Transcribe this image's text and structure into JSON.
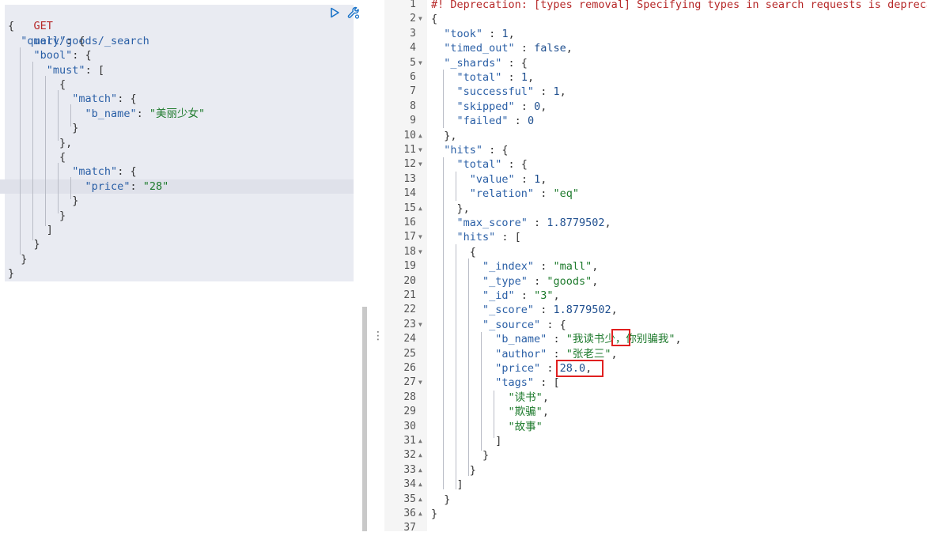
{
  "request": {
    "method": "GET",
    "path": "mall/goods/_search",
    "lines": [
      [
        [
          "p",
          "{"
        ]
      ],
      [
        [
          "p",
          "  "
        ],
        [
          "k",
          "\"query\""
        ],
        [
          "p",
          ": {"
        ]
      ],
      [
        [
          "p",
          "    "
        ],
        [
          "k",
          "\"bool\""
        ],
        [
          "p",
          ": {"
        ]
      ],
      [
        [
          "p",
          "      "
        ],
        [
          "k",
          "\"must\""
        ],
        [
          "p",
          ": ["
        ]
      ],
      [
        [
          "p",
          "        {"
        ]
      ],
      [
        [
          "p",
          "          "
        ],
        [
          "k",
          "\"match\""
        ],
        [
          "p",
          ": {"
        ]
      ],
      [
        [
          "p",
          "            "
        ],
        [
          "k",
          "\"b_name\""
        ],
        [
          "p",
          ": "
        ],
        [
          "s",
          "\"美丽少女\""
        ]
      ],
      [
        [
          "p",
          "          }"
        ]
      ],
      [
        [
          "p",
          "        },"
        ]
      ],
      [
        [
          "p",
          "        {"
        ]
      ],
      [
        [
          "p",
          "          "
        ],
        [
          "k",
          "\"match\""
        ],
        [
          "p",
          ": {"
        ]
      ],
      [
        [
          "p",
          "            "
        ],
        [
          "k",
          "\"price\""
        ],
        [
          "p",
          ": "
        ],
        [
          "s",
          "\"28\""
        ]
      ],
      [
        [
          "p",
          "          }"
        ]
      ],
      [
        [
          "p",
          "        }"
        ]
      ],
      [
        [
          "p",
          "      ]"
        ]
      ],
      [
        [
          "p",
          "    }"
        ]
      ],
      [
        [
          "p",
          "  }"
        ]
      ],
      [
        [
          "p",
          "}"
        ]
      ]
    ],
    "run_icon": "play-icon",
    "settings_icon": "wrench-icon"
  },
  "resizer_glyph": "⋮",
  "response": {
    "lines": [
      {
        "n": "1",
        "f": "",
        "t": [
          [
            "c",
            "#! Deprecation: [types removal] Specifying types in search requests is deprecated."
          ]
        ]
      },
      {
        "n": "2",
        "f": "down",
        "t": [
          [
            "p",
            "{"
          ]
        ]
      },
      {
        "n": "3",
        "f": "",
        "t": [
          [
            "p",
            "  "
          ],
          [
            "k",
            "\"took\""
          ],
          [
            "p",
            " : "
          ],
          [
            "n",
            "1"
          ],
          [
            "p",
            ","
          ]
        ]
      },
      {
        "n": "4",
        "f": "",
        "t": [
          [
            "p",
            "  "
          ],
          [
            "k",
            "\"timed_out\""
          ],
          [
            "p",
            " : "
          ],
          [
            "b",
            "false"
          ],
          [
            "p",
            ","
          ]
        ]
      },
      {
        "n": "5",
        "f": "down",
        "t": [
          [
            "p",
            "  "
          ],
          [
            "k",
            "\"_shards\""
          ],
          [
            "p",
            " : {"
          ]
        ]
      },
      {
        "n": "6",
        "f": "",
        "t": [
          [
            "p",
            "    "
          ],
          [
            "k",
            "\"total\""
          ],
          [
            "p",
            " : "
          ],
          [
            "n",
            "1"
          ],
          [
            "p",
            ","
          ]
        ]
      },
      {
        "n": "7",
        "f": "",
        "t": [
          [
            "p",
            "    "
          ],
          [
            "k",
            "\"successful\""
          ],
          [
            "p",
            " : "
          ],
          [
            "n",
            "1"
          ],
          [
            "p",
            ","
          ]
        ]
      },
      {
        "n": "8",
        "f": "",
        "t": [
          [
            "p",
            "    "
          ],
          [
            "k",
            "\"skipped\""
          ],
          [
            "p",
            " : "
          ],
          [
            "n",
            "0"
          ],
          [
            "p",
            ","
          ]
        ]
      },
      {
        "n": "9",
        "f": "",
        "t": [
          [
            "p",
            "    "
          ],
          [
            "k",
            "\"failed\""
          ],
          [
            "p",
            " : "
          ],
          [
            "n",
            "0"
          ]
        ]
      },
      {
        "n": "10",
        "f": "up",
        "t": [
          [
            "p",
            "  },"
          ]
        ]
      },
      {
        "n": "11",
        "f": "down",
        "t": [
          [
            "p",
            "  "
          ],
          [
            "k",
            "\"hits\""
          ],
          [
            "p",
            " : {"
          ]
        ]
      },
      {
        "n": "12",
        "f": "down",
        "t": [
          [
            "p",
            "    "
          ],
          [
            "k",
            "\"total\""
          ],
          [
            "p",
            " : {"
          ]
        ]
      },
      {
        "n": "13",
        "f": "",
        "t": [
          [
            "p",
            "      "
          ],
          [
            "k",
            "\"value\""
          ],
          [
            "p",
            " : "
          ],
          [
            "n",
            "1"
          ],
          [
            "p",
            ","
          ]
        ]
      },
      {
        "n": "14",
        "f": "",
        "t": [
          [
            "p",
            "      "
          ],
          [
            "k",
            "\"relation\""
          ],
          [
            "p",
            " : "
          ],
          [
            "s",
            "\"eq\""
          ]
        ]
      },
      {
        "n": "15",
        "f": "up",
        "t": [
          [
            "p",
            "    },"
          ]
        ]
      },
      {
        "n": "16",
        "f": "",
        "t": [
          [
            "p",
            "    "
          ],
          [
            "k",
            "\"max_score\""
          ],
          [
            "p",
            " : "
          ],
          [
            "n",
            "1.8779502"
          ],
          [
            "p",
            ","
          ]
        ]
      },
      {
        "n": "17",
        "f": "down",
        "t": [
          [
            "p",
            "    "
          ],
          [
            "k",
            "\"hits\""
          ],
          [
            "p",
            " : ["
          ]
        ]
      },
      {
        "n": "18",
        "f": "down",
        "t": [
          [
            "p",
            "      {"
          ]
        ]
      },
      {
        "n": "19",
        "f": "",
        "t": [
          [
            "p",
            "        "
          ],
          [
            "k",
            "\"_index\""
          ],
          [
            "p",
            " : "
          ],
          [
            "s",
            "\"mall\""
          ],
          [
            "p",
            ","
          ]
        ]
      },
      {
        "n": "20",
        "f": "",
        "t": [
          [
            "p",
            "        "
          ],
          [
            "k",
            "\"_type\""
          ],
          [
            "p",
            " : "
          ],
          [
            "s",
            "\"goods\""
          ],
          [
            "p",
            ","
          ]
        ]
      },
      {
        "n": "21",
        "f": "",
        "t": [
          [
            "p",
            "        "
          ],
          [
            "k",
            "\"_id\""
          ],
          [
            "p",
            " : "
          ],
          [
            "s",
            "\"3\""
          ],
          [
            "p",
            ","
          ]
        ]
      },
      {
        "n": "22",
        "f": "",
        "t": [
          [
            "p",
            "        "
          ],
          [
            "k",
            "\"_score\""
          ],
          [
            "p",
            " : "
          ],
          [
            "n",
            "1.8779502"
          ],
          [
            "p",
            ","
          ]
        ]
      },
      {
        "n": "23",
        "f": "down",
        "t": [
          [
            "p",
            "        "
          ],
          [
            "k",
            "\"_source\""
          ],
          [
            "p",
            " : {"
          ]
        ]
      },
      {
        "n": "24",
        "f": "",
        "t": [
          [
            "p",
            "          "
          ],
          [
            "k",
            "\"b_name\""
          ],
          [
            "p",
            " : "
          ],
          [
            "s",
            "\"我读书少，你别骗我\""
          ],
          [
            "p",
            ","
          ]
        ]
      },
      {
        "n": "25",
        "f": "",
        "t": [
          [
            "p",
            "          "
          ],
          [
            "k",
            "\"author\""
          ],
          [
            "p",
            " : "
          ],
          [
            "s",
            "\"张老三\""
          ],
          [
            "p",
            ","
          ]
        ]
      },
      {
        "n": "26",
        "f": "",
        "t": [
          [
            "p",
            "          "
          ],
          [
            "k",
            "\"price\""
          ],
          [
            "p",
            " : "
          ],
          [
            "n",
            "28.0"
          ],
          [
            "p",
            ","
          ]
        ]
      },
      {
        "n": "27",
        "f": "down",
        "t": [
          [
            "p",
            "          "
          ],
          [
            "k",
            "\"tags\""
          ],
          [
            "p",
            " : ["
          ]
        ]
      },
      {
        "n": "28",
        "f": "",
        "t": [
          [
            "p",
            "            "
          ],
          [
            "s",
            "\"读书\""
          ],
          [
            "p",
            ","
          ]
        ]
      },
      {
        "n": "29",
        "f": "",
        "t": [
          [
            "p",
            "            "
          ],
          [
            "s",
            "\"欺骗\""
          ],
          [
            "p",
            ","
          ]
        ]
      },
      {
        "n": "30",
        "f": "",
        "t": [
          [
            "p",
            "            "
          ],
          [
            "s",
            "\"故事\""
          ]
        ]
      },
      {
        "n": "31",
        "f": "up",
        "t": [
          [
            "p",
            "          ]"
          ]
        ]
      },
      {
        "n": "32",
        "f": "up",
        "t": [
          [
            "p",
            "        }"
          ]
        ]
      },
      {
        "n": "33",
        "f": "up",
        "t": [
          [
            "p",
            "      }"
          ]
        ]
      },
      {
        "n": "34",
        "f": "up",
        "t": [
          [
            "p",
            "    ]"
          ]
        ]
      },
      {
        "n": "35",
        "f": "up",
        "t": [
          [
            "p",
            "  }"
          ]
        ]
      },
      {
        "n": "36",
        "f": "up",
        "t": [
          [
            "p",
            "}"
          ]
        ]
      },
      {
        "n": "37",
        "f": "",
        "t": []
      }
    ]
  },
  "colors": {
    "keyword": "#2a5fa6",
    "string": "#1d7a2c",
    "number": "#1f4f8f",
    "comment": "#b62828",
    "highlight_box": "#e02020"
  }
}
